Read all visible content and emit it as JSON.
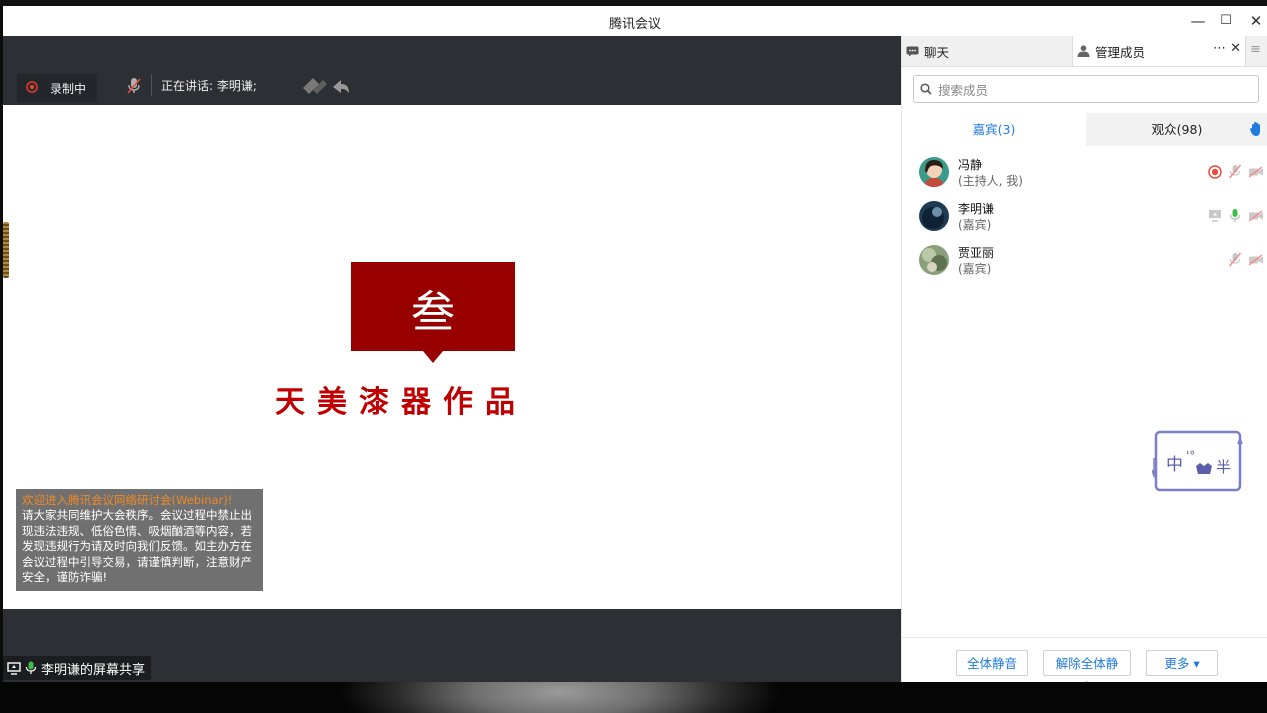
{
  "window": {
    "title": "腾讯会议",
    "minimize": "—",
    "maximize": "☐",
    "close": "✕"
  },
  "toolbar": {
    "recording_label": "录制中",
    "speaking": "正在讲话: 李明谦;"
  },
  "slide": {
    "box_char": "叁",
    "caption": "天美漆器作品"
  },
  "notice": {
    "title": "欢迎进入腾讯会议网络研讨会(Webinar)!",
    "body": "请大家共同维护大会秩序。会议过程中禁止出现违法违规、低俗色情、吸烟酗酒等内容，若发现违规行为请及时向我们反馈。如主办方在会议过程中引导交易，请谨慎判断，注意财产安全，谨防诈骗!"
  },
  "share": {
    "label": "李明谦的屏幕共享"
  },
  "panel": {
    "tab_chat": "聊天",
    "tab_members": "管理成员",
    "tab_more": "⋯",
    "tab_close": "✕",
    "menu": "≡",
    "search_placeholder": "搜索成员",
    "tab_guests": "嘉宾(3)",
    "tab_audience": "观众(98)",
    "members": [
      {
        "name": "冯静",
        "role": "(主持人, 我)"
      },
      {
        "name": "李明谦",
        "role": "(嘉宾)"
      },
      {
        "name": "贾亚丽",
        "role": "(嘉宾)"
      }
    ],
    "stamp_text": "中",
    "stamp_text2": "半",
    "buttons": {
      "mute_all": "全体静音",
      "unmute_all": "解除全体静音",
      "more": "更多 ▾"
    }
  },
  "colors": {
    "accent": "#1e7be0",
    "record": "#e74c3c",
    "slide_red": "#980000",
    "notice_title": "#f08a24"
  }
}
